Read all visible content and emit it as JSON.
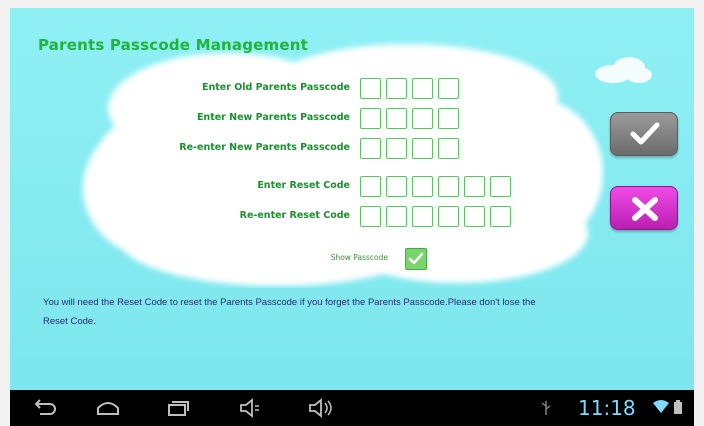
{
  "screen": {
    "title": "Parents Passcode Management",
    "fields": [
      {
        "label": "Enter Old Parents Passcode",
        "length": 4
      },
      {
        "label": "Enter New Parents Passcode",
        "length": 4
      },
      {
        "label": "Re-enter New Parents Passcode",
        "length": 4
      },
      {
        "label": "Enter Reset Code",
        "length": 6
      },
      {
        "label": "Re-enter Reset Code",
        "length": 6
      }
    ],
    "show_passcode": {
      "label": "Show Passcode",
      "checked": true
    },
    "note": "You will need the Reset Code to reset the Parents Passcode if you forget the Parents Passcode.Please don't lose the Reset Code.",
    "confirm_icon": "checkmark-icon",
    "cancel_icon": "close-x-icon"
  },
  "navbar": {
    "buttons": [
      "back-icon",
      "home-icon",
      "recent-apps-icon",
      "volume-down-icon",
      "volume-up-icon"
    ],
    "time": "11:18",
    "status_icons": [
      "usb-icon",
      "wifi-icon",
      "battery-icon"
    ],
    "clock_color": "#7fd9ff"
  },
  "colors": {
    "background": "#8ff0f4",
    "title": "#1fb43a",
    "labels": "#1c8f2e",
    "confirm_button": "#8a8a8a",
    "cancel_button": "#e03ad8"
  }
}
